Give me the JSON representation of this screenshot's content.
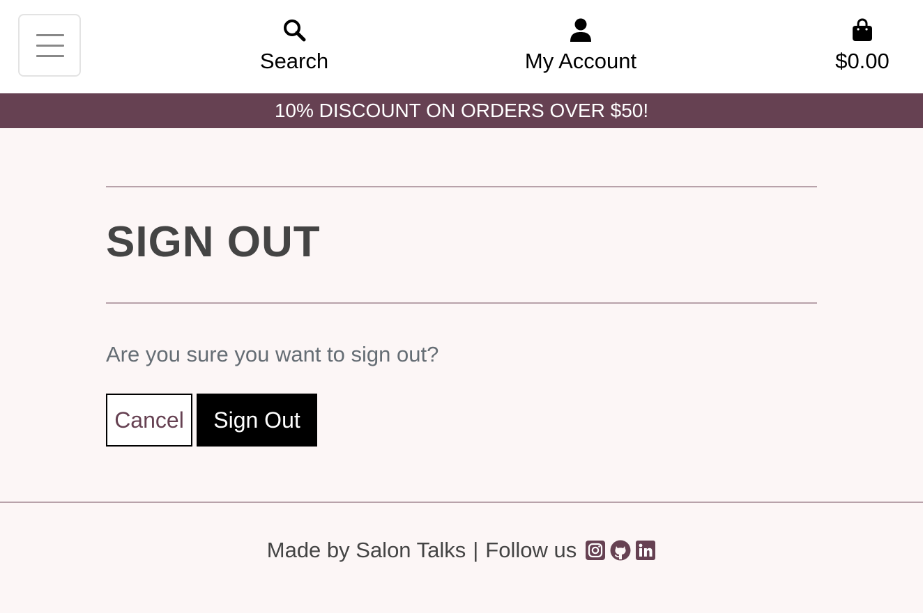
{
  "header": {
    "menu_icon": "hamburger-icon",
    "search": {
      "label": "Search",
      "icon": "search-icon"
    },
    "account": {
      "label": "My Account",
      "icon": "user-icon"
    },
    "cart": {
      "label": "$0.00",
      "icon": "shopping-bag-icon"
    }
  },
  "banner": {
    "text": "10% DISCOUNT ON ORDERS OVER $50!"
  },
  "main": {
    "title": "SIGN OUT",
    "question": "Are you sure you want to sign out?",
    "cancel_label": "Cancel",
    "signout_label": "Sign Out"
  },
  "footer": {
    "made_by": "Made by Salon Talks",
    "separator": "|",
    "follow": "Follow us",
    "social": [
      "instagram-icon",
      "github-icon",
      "linkedin-icon"
    ]
  },
  "colors": {
    "accent": "#664152",
    "background": "#fcf6f6",
    "button_dark": "#000000"
  }
}
